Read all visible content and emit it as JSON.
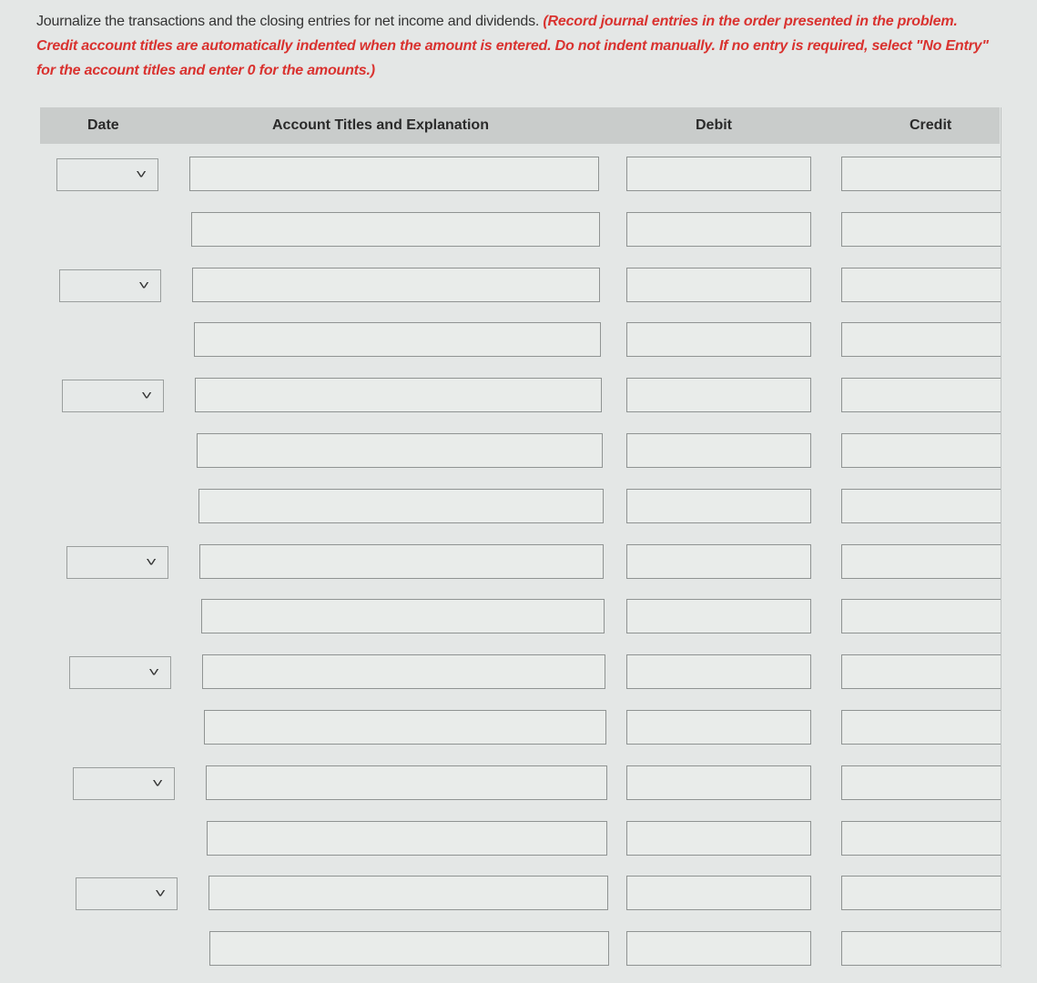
{
  "instructions": {
    "normal": "Journalize the transactions and the closing entries for net income and dividends. ",
    "emphasis": "(Record journal entries in the order presented in the problem. Credit account titles are automatically indented when the amount is entered. Do not indent manually. If no entry is required, select \"No Entry\" for the account titles and enter 0 for the amounts.)"
  },
  "table": {
    "headers": {
      "date": "Date",
      "account": "Account Titles and Explanation",
      "debit": "Debit",
      "credit": "Credit"
    },
    "rows": [
      {
        "has_date": true,
        "date": "",
        "account": "",
        "debit": "",
        "credit": ""
      },
      {
        "has_date": false,
        "date": "",
        "account": "",
        "debit": "",
        "credit": ""
      },
      {
        "has_date": true,
        "date": "",
        "account": "",
        "debit": "",
        "credit": ""
      },
      {
        "has_date": false,
        "date": "",
        "account": "",
        "debit": "",
        "credit": ""
      },
      {
        "has_date": true,
        "date": "",
        "account": "",
        "debit": "",
        "credit": ""
      },
      {
        "has_date": false,
        "date": "",
        "account": "",
        "debit": "",
        "credit": ""
      },
      {
        "has_date": false,
        "date": "",
        "account": "",
        "debit": "",
        "credit": ""
      },
      {
        "has_date": true,
        "date": "",
        "account": "",
        "debit": "",
        "credit": ""
      },
      {
        "has_date": false,
        "date": "",
        "account": "",
        "debit": "",
        "credit": ""
      },
      {
        "has_date": true,
        "date": "",
        "account": "",
        "debit": "",
        "credit": ""
      },
      {
        "has_date": false,
        "date": "",
        "account": "",
        "debit": "",
        "credit": ""
      },
      {
        "has_date": true,
        "date": "",
        "account": "",
        "debit": "",
        "credit": ""
      },
      {
        "has_date": false,
        "date": "",
        "account": "",
        "debit": "",
        "credit": ""
      },
      {
        "has_date": true,
        "date": "",
        "account": "",
        "debit": "",
        "credit": ""
      },
      {
        "has_date": false,
        "date": "",
        "account": "",
        "debit": "",
        "credit": ""
      }
    ]
  },
  "icons": {
    "dropdown": "chevron-down-icon"
  }
}
